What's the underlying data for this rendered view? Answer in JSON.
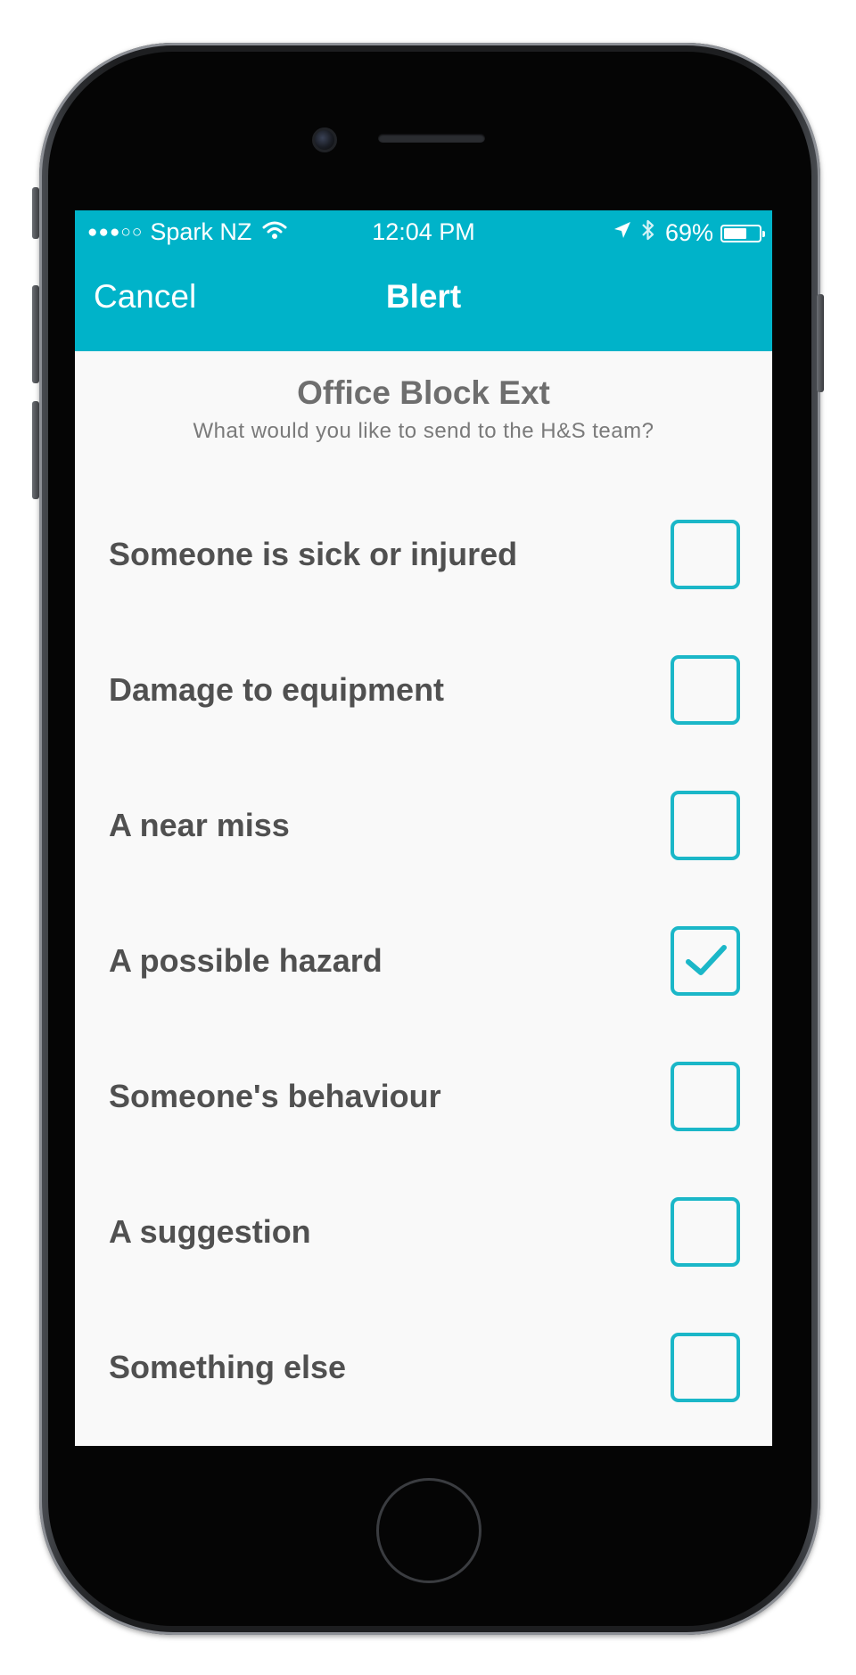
{
  "status_bar": {
    "signal": "●●●○○",
    "carrier": "Spark NZ",
    "time": "12:04 PM",
    "battery_percent": "69%",
    "battery_level": 0.69,
    "icons": [
      "wifi-icon",
      "location-arrow-icon",
      "bluetooth-icon",
      "battery-icon"
    ]
  },
  "nav": {
    "cancel_label": "Cancel",
    "title": "Blert"
  },
  "header": {
    "title": "Office Block Ext",
    "subtitle": "What would you like to send to the H&S team?"
  },
  "options": [
    {
      "label": "Someone is sick or injured",
      "checked": false
    },
    {
      "label": "Damage to equipment",
      "checked": false
    },
    {
      "label": "A near miss",
      "checked": false
    },
    {
      "label": "A possible hazard",
      "checked": true
    },
    {
      "label": "Someone's behaviour",
      "checked": false
    },
    {
      "label": "A suggestion",
      "checked": false
    },
    {
      "label": "Something else",
      "checked": false
    }
  ],
  "colors": {
    "accent": "#00b3c9",
    "checkbox_border": "#1bb7c8",
    "background": "#f9f9f9",
    "text": "#505050"
  }
}
